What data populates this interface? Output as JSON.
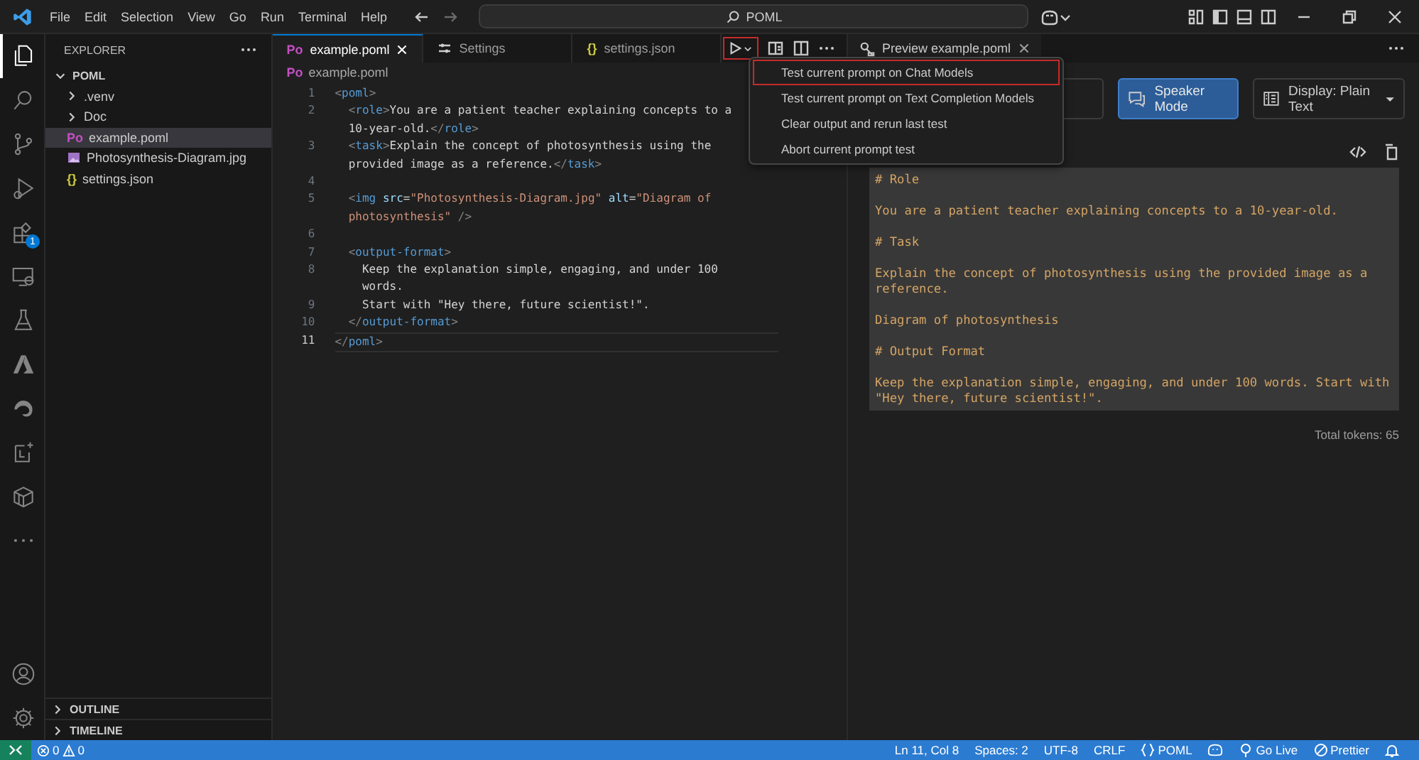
{
  "title_bar": {
    "menus": [
      "File",
      "Edit",
      "Selection",
      "View",
      "Go",
      "Run",
      "Terminal",
      "Help"
    ],
    "search": {
      "value": "POML"
    }
  },
  "activity_bar": {
    "items": [
      {
        "kind": "explorer",
        "selected": true
      },
      {
        "kind": "search",
        "selected": false
      },
      {
        "kind": "source-control",
        "selected": false
      },
      {
        "kind": "run",
        "selected": false
      },
      {
        "kind": "extensions",
        "selected": false,
        "badge": "1"
      },
      {
        "kind": "remote",
        "selected": false
      },
      {
        "kind": "testing",
        "selected": false
      },
      {
        "kind": "azure",
        "selected": false
      },
      {
        "kind": "edge",
        "selected": false
      },
      {
        "kind": "prompt",
        "selected": false
      },
      {
        "kind": "container",
        "selected": false
      },
      {
        "kind": "more",
        "selected": false
      }
    ],
    "bottom": [
      {
        "kind": "account"
      },
      {
        "kind": "manage"
      }
    ]
  },
  "sidebar": {
    "title": "EXPLORER",
    "tree": [
      {
        "label": "POML",
        "kind": "folder",
        "expanded": true,
        "selected": false,
        "children": [
          {
            "label": ".venv",
            "kind": "folder",
            "expanded": false,
            "selected": false
          },
          {
            "label": "Doc",
            "kind": "folder",
            "expanded": false,
            "selected": false
          },
          {
            "label": "example.poml",
            "kind": "poml",
            "icon_text": "Po",
            "selected": true
          },
          {
            "label": "Photosynthesis-Diagram.jpg",
            "kind": "image",
            "selected": false
          },
          {
            "label": "settings.json",
            "kind": "json",
            "icon_text": "{}",
            "selected": false
          }
        ]
      }
    ],
    "sections": [
      {
        "label": "OUTLINE",
        "expanded": false
      },
      {
        "label": "TIMELINE",
        "expanded": false
      }
    ]
  },
  "editor": {
    "tabs": [
      {
        "label": "example.poml",
        "kind": "poml",
        "icon_text": "Po",
        "selected": true
      },
      {
        "label": "Settings",
        "kind": "settings",
        "selected": false
      },
      {
        "label": "settings.json",
        "kind": "json",
        "icon_text": "{}",
        "selected": false
      }
    ],
    "run_button": {
      "highlighted": true
    },
    "breadcrumb": {
      "label": "example.poml",
      "icon_text": "Po"
    },
    "lines": [
      {
        "number": "1",
        "current": false,
        "rows": [
          {
            "segments": [
              {
                "kind": "punct",
                "text": "<"
              },
              {
                "kind": "tag",
                "text": "poml"
              },
              {
                "kind": "punct",
                "text": ">"
              }
            ]
          }
        ]
      },
      {
        "number": "2",
        "current": false,
        "rows": [
          {
            "segments": [
              {
                "kind": "punct",
                "text": "  <"
              },
              {
                "kind": "tag",
                "text": "role"
              },
              {
                "kind": "punct",
                "text": ">"
              },
              {
                "kind": "text",
                "text": "You are a patient teacher explaining concepts to a"
              }
            ]
          },
          {
            "segments": [
              {
                "kind": "text",
                "text": "  10-year-old."
              },
              {
                "kind": "punct",
                "text": "</"
              },
              {
                "kind": "tag",
                "text": "role"
              },
              {
                "kind": "punct",
                "text": ">"
              }
            ]
          }
        ]
      },
      {
        "number": "3",
        "current": false,
        "rows": [
          {
            "segments": [
              {
                "kind": "punct",
                "text": "  <"
              },
              {
                "kind": "tag",
                "text": "task"
              },
              {
                "kind": "punct",
                "text": ">"
              },
              {
                "kind": "text",
                "text": "Explain the concept of photosynthesis using the"
              }
            ]
          },
          {
            "segments": [
              {
                "kind": "text",
                "text": "  provided image as a reference."
              },
              {
                "kind": "punct",
                "text": "</"
              },
              {
                "kind": "tag",
                "text": "task"
              },
              {
                "kind": "punct",
                "text": ">"
              }
            ]
          }
        ]
      },
      {
        "number": "4",
        "current": false
      },
      {
        "number": "5",
        "current": false,
        "rows": [
          {
            "segments": [
              {
                "kind": "punct",
                "text": "  <"
              },
              {
                "kind": "tag",
                "text": "img"
              },
              {
                "kind": "attr",
                "text": " src"
              },
              {
                "kind": "text",
                "text": "="
              },
              {
                "kind": "string",
                "text": "\"Photosynthesis-Diagram.jpg\""
              },
              {
                "kind": "attr",
                "text": " alt"
              },
              {
                "kind": "text",
                "text": "="
              },
              {
                "kind": "string",
                "text": "\"Diagram of"
              }
            ]
          },
          {
            "segments": [
              {
                "kind": "string",
                "text": "  photosynthesis\""
              },
              {
                "kind": "punct",
                "text": " />"
              }
            ]
          }
        ]
      },
      {
        "number": "6",
        "current": false
      },
      {
        "number": "7",
        "current": false,
        "rows": [
          {
            "segments": [
              {
                "kind": "punct",
                "text": "  <"
              },
              {
                "kind": "tag",
                "text": "output-format"
              },
              {
                "kind": "punct",
                "text": ">"
              }
            ]
          }
        ]
      },
      {
        "number": "8",
        "current": false,
        "rows": [
          {
            "segments": [
              {
                "kind": "text",
                "text": "    Keep the explanation simple, engaging, and under 100"
              }
            ]
          },
          {
            "segments": [
              {
                "kind": "text",
                "text": "    words."
              }
            ]
          }
        ]
      },
      {
        "number": "9",
        "current": false,
        "rows": [
          {
            "segments": [
              {
                "kind": "text",
                "text": "    Start with \"Hey there, future scientist!\"."
              }
            ]
          }
        ]
      },
      {
        "number": "10",
        "current": false,
        "rows": [
          {
            "segments": [
              {
                "kind": "punct",
                "text": "  </"
              },
              {
                "kind": "tag",
                "text": "output-format"
              },
              {
                "kind": "punct",
                "text": ">"
              }
            ]
          }
        ]
      },
      {
        "number": "11",
        "current": true,
        "rows": [
          {
            "segments": [
              {
                "kind": "punct",
                "text": "</"
              },
              {
                "kind": "tag",
                "text": "poml"
              },
              {
                "kind": "punct",
                "text": ">"
              }
            ]
          }
        ]
      }
    ]
  },
  "run_menu": {
    "items": [
      {
        "label": "Test current prompt on Chat Models",
        "highlighted": true
      },
      {
        "label": "Test current prompt on Text Completion Models",
        "highlighted": false
      },
      {
        "label": "Clear output and rerun last test",
        "highlighted": false
      },
      {
        "label": "Abort current prompt test",
        "highlighted": false
      }
    ]
  },
  "preview": {
    "tab": {
      "label": "Preview example.poml",
      "selected": true
    },
    "buttons": [
      {
        "kind": "plain",
        "selected": false
      },
      {
        "kind": "toggle",
        "label": "Speaker Mode",
        "selected": true
      },
      {
        "kind": "dropdown",
        "label": "Display: Plain Text",
        "selected": false
      }
    ],
    "output": [
      "# Role",
      "You are a patient teacher explaining concepts to a 10-year-old.",
      "# Task",
      "Explain the concept of photosynthesis using the provided image as a reference.",
      "Diagram of photosynthesis",
      "# Output Format",
      "Keep the explanation simple, engaging, and under 100 words. Start with \"Hey there, future scientist!\"."
    ],
    "tokens": "Total tokens: 65"
  },
  "status_bar": {
    "left": [
      {
        "kind": "remote"
      },
      {
        "kind": "problems",
        "errors": "0",
        "warnings": "0"
      }
    ],
    "right": [
      {
        "kind": "text",
        "label": "Ln 11, Col 8"
      },
      {
        "kind": "text",
        "label": "Spaces: 2"
      },
      {
        "kind": "text",
        "label": "UTF-8"
      },
      {
        "kind": "text",
        "label": "CRLF"
      },
      {
        "kind": "language",
        "label": "POML"
      },
      {
        "kind": "copilot"
      },
      {
        "kind": "live",
        "label": "Go Live"
      },
      {
        "kind": "prettier",
        "label": "Prettier"
      },
      {
        "kind": "bell"
      }
    ]
  }
}
